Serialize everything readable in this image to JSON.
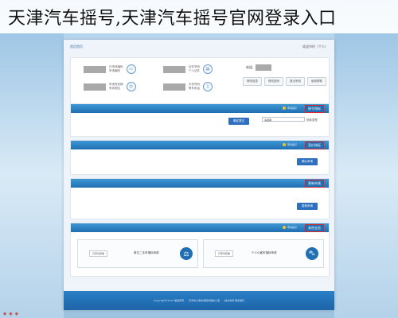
{
  "caption": "天津汽车摇号,天津汽车摇号官网登录入口",
  "crumb": {
    "left": "首页首页",
    "right": "欢迎节约（个人）"
  },
  "user": {
    "greeting": "欢迎,",
    "tabs": [
      "修改信息",
      "修改密码",
      "退出系统",
      "使用帮助"
    ]
  },
  "info": [
    {
      "label_top": "已申请编码",
      "label_bot": "申请编码",
      "icon": "id-icon",
      "glyph": "▭"
    },
    {
      "label_top": "证件号码",
      "label_bot": "个人证件",
      "icon": "card-icon",
      "glyph": "▤"
    },
    {
      "label_top": "申请有效期",
      "label_bot": "有效期至",
      "icon": "clock-icon",
      "glyph": "◷"
    },
    {
      "label_top": "手机号码",
      "label_bot": "联系电话",
      "icon": "phone-icon",
      "glyph": "▯"
    }
  ],
  "sections": [
    {
      "title": "摇号指标",
      "note": "申请提示",
      "select_label": "指标类型",
      "select_value": "请选择",
      "button": "确定提交"
    },
    {
      "title": "竞价指标",
      "note": "申请提示",
      "button": "确认申请"
    },
    {
      "title": "更新申请",
      "button": "更新申请"
    },
    {
      "title": "其他业务",
      "note": "申请提示"
    }
  ],
  "cards": [
    {
      "text": "个人小客车指标申请",
      "button": "已申请查看"
    },
    {
      "text": "单位二手车指标申请",
      "button": "已申请查看"
    }
  ],
  "footer": {
    "left": "Copyright©2013 版权所有",
    "mid": "天津市小客车调控管理办公室",
    "right": "技术支持 联系我们"
  },
  "colors": {
    "header_blue": "#1f6fb2",
    "accent_red": "#d9262e",
    "button_blue": "#2f6fbf"
  }
}
